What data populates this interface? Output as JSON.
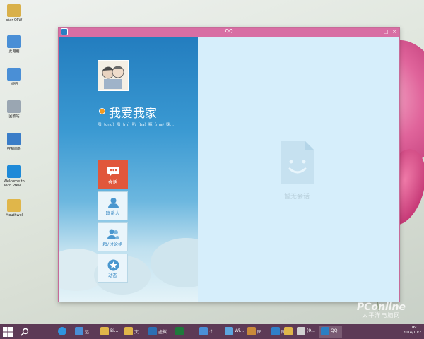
{
  "desktop": {
    "icons": [
      {
        "label": "star 06W",
        "icon": "folder-user-icon",
        "color": "#d9b04a"
      },
      {
        "label": "此电脑",
        "icon": "computer-icon",
        "color": "#4a8fd6"
      },
      {
        "label": "网络",
        "icon": "network-icon",
        "color": "#4a8fd6"
      },
      {
        "label": "回收站",
        "icon": "recycle-bin-icon",
        "color": "#9aa6b2"
      },
      {
        "label": "控制面板",
        "icon": "control-panel-icon",
        "color": "#3a7dc8"
      },
      {
        "label": "Welcome to Tech Previ...",
        "icon": "windows-icon",
        "color": "#1e8ad8"
      },
      {
        "label": "Mouthwel",
        "icon": "folder-icon",
        "color": "#e0b64a"
      }
    ]
  },
  "window": {
    "title": "QQ",
    "title_color": "#d86ea4",
    "controls": {
      "minimize": "–",
      "maximize": "□",
      "close": "×"
    }
  },
  "profile": {
    "nickname": "我爱我家",
    "status_color": "#f29a1f",
    "signature": "嗡（ong）嗡（m）叭（ba）嘛（ma）咪..."
  },
  "nav": {
    "items": [
      {
        "label": "会话",
        "icon": "chat-bubble-icon",
        "active": true
      },
      {
        "label": "联系人",
        "icon": "contact-person-icon",
        "active": false
      },
      {
        "label": "群/讨论组",
        "icon": "group-icon",
        "active": false
      },
      {
        "label": "动态",
        "icon": "star-feed-icon",
        "active": false
      }
    ]
  },
  "main": {
    "empty_text": "暂无会话",
    "empty_icon": "empty-document-face-icon"
  },
  "taskbar": {
    "items": [
      {
        "label": "",
        "icon": "start-windows-icon",
        "color": "#ffffff"
      },
      {
        "label": "",
        "icon": "search-icon",
        "color": "#ffffff"
      },
      {
        "label": "",
        "icon": "ie-browser-icon",
        "color": "#2f95e0"
      },
      {
        "label": "远...",
        "icon": "remote-desktop-icon",
        "color": "#4a8fd6"
      },
      {
        "label": "Bi...",
        "icon": "folder-icon",
        "color": "#e0b64a"
      },
      {
        "label": "文...",
        "icon": "folder-icon",
        "color": "#e0b64a"
      },
      {
        "label": "虚拟...",
        "icon": "vm-icon",
        "color": "#2c6fb3"
      },
      {
        "label": "",
        "icon": "excel-icon",
        "color": "#1e7a3c"
      },
      {
        "label": "个...",
        "icon": "monitor-icon",
        "color": "#4a8fd6"
      },
      {
        "label": "Wi...",
        "icon": "app-icon",
        "color": "#5da6df"
      },
      {
        "label": "图...",
        "icon": "image-icon",
        "color": "#c98a3a"
      },
      {
        "label": "图...",
        "icon": "app-n-icon",
        "color": "#2f7fc8"
      },
      {
        "label": "快...",
        "icon": "folder-icon",
        "color": "#e0b64a"
      },
      {
        "label": "(9...",
        "icon": "notepad-icon",
        "color": "#d0d0d0"
      },
      {
        "label": "QQ",
        "icon": "qq-icon",
        "color": "#2a7fc3",
        "active": true
      }
    ],
    "time": "16:11",
    "date": "2014/10/2"
  },
  "watermark": {
    "line1": "PConline",
    "line2": "太平洋电脑网"
  }
}
